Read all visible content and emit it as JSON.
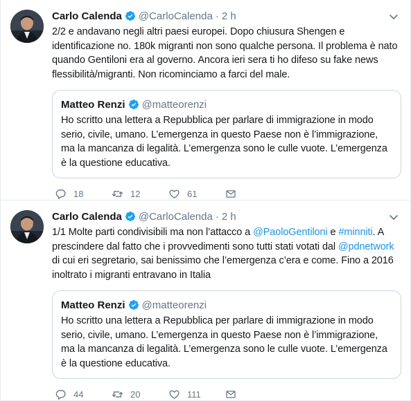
{
  "tweets": [
    {
      "author_name": "Carlo Calenda",
      "author_handle": "@CarloCalenda",
      "separator": "·",
      "time": "2 h",
      "text_parts": [
        {
          "t": "2/2 e andavano negli altri paesi europei. Dopo chiusura Shengen e identificazione no.  180k migranti non sono qualche persona. Il problema è nato quando Gentiloni era al governo. Ancora ieri sera ti ho difeso su fake news flessibilità/migranti. Non ricominciamo a farci del male."
        }
      ],
      "quote": {
        "author_name": "Matteo Renzi",
        "author_handle": "@matteorenzi",
        "text": "Ho scritto una lettera a Repubblica per parlare di immigrazione in modo serio, civile, umano. L’emergenza in questo Paese non è l’immigrazione, ma la mancanza di legalità. L’emergenza sono le culle vuote. L’emergenza è la questione educativa."
      },
      "replies": "18",
      "retweets": "12",
      "likes": "61"
    },
    {
      "author_name": "Carlo Calenda",
      "author_handle": "@CarloCalenda",
      "separator": "·",
      "time": "2 h",
      "text_parts": [
        {
          "t": "1/1 Molte parti condivisibili ma non l’attacco a "
        },
        {
          "t": "@PaoloGentiloni",
          "link": true
        },
        {
          "t": " e "
        },
        {
          "t": "#minniti",
          "link": true
        },
        {
          "t": ".  A prescindere dal fatto che i provvedimenti sono tutti stati votati dal "
        },
        {
          "t": "@pdnetwork",
          "link": true
        },
        {
          "t": " di cui eri segretario, sai benissimo che l’emergenza c’era e come. Fino a 2016 inoltrato i migranti entravano in Italia"
        }
      ],
      "quote": {
        "author_name": "Matteo Renzi",
        "author_handle": "@matteorenzi",
        "text": "Ho scritto una lettera a Repubblica per parlare di immigrazione in modo serio, civile, umano. L’emergenza in questo Paese non è l’immigrazione, ma la mancanza di legalità. L’emergenza sono le culle vuote. L’emergenza è la questione educativa."
      },
      "replies": "44",
      "retweets": "20",
      "likes": "111"
    }
  ],
  "icons": {
    "verified": "verified-badge-icon",
    "caret": "chevron-down-icon",
    "reply": "reply-icon",
    "retweet": "retweet-icon",
    "like": "heart-icon",
    "message": "direct-message-icon"
  },
  "colors": {
    "link": "#1b95e0",
    "verified": "#1da1f2",
    "muted": "#657786",
    "border": "#e6ecf0"
  }
}
